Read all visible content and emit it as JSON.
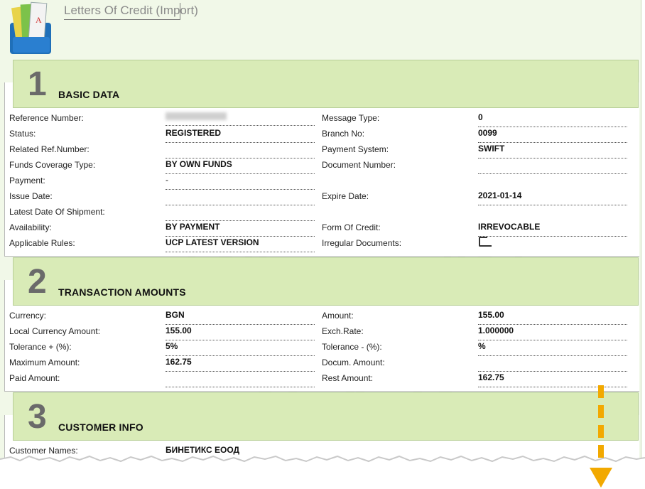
{
  "page": {
    "title": "Letters Of Credit (Import)"
  },
  "icons": {
    "app_icon": "document-binder-icon",
    "scroll_hint": "dashed-down-arrow-icon"
  },
  "colors": {
    "section_header_bg": "#d9ebb7",
    "page_bg": "#f1f8e8",
    "arrow": "#f2a900"
  },
  "sections": [
    {
      "number": "1",
      "title": "BASIC DATA",
      "rows": [
        {
          "left_label": "Reference Number:",
          "left_value": "",
          "right_label": "Message Type:",
          "right_value": "0"
        },
        {
          "left_label": "Status:",
          "left_value": "REGISTERED",
          "right_label": "Branch No:",
          "right_value": "0099"
        },
        {
          "left_label": "Related Ref.Number:",
          "left_value": "",
          "right_label": "Payment System:",
          "right_value": "SWIFT"
        },
        {
          "left_label": "Funds Coverage Type:",
          "left_value": "BY OWN FUNDS",
          "right_label": "Document Number:",
          "right_value": ""
        },
        {
          "left_label": "Payment:",
          "left_value": "-",
          "right_label": "",
          "right_value": ""
        },
        {
          "left_label": "Issue Date:",
          "left_value": "",
          "right_label": "Expire Date:",
          "right_value": "2021-01-14"
        },
        {
          "left_label": "Latest Date Of Shipment:",
          "left_value": "",
          "right_label": "",
          "right_value": ""
        },
        {
          "left_label": "Availability:",
          "left_value": "BY PAYMENT",
          "right_label": "Form Of Credit:",
          "right_value": "IRREVOCABLE"
        },
        {
          "left_label": "Applicable Rules:",
          "left_value": "UCP LATEST VERSION",
          "right_label": "Irregular Documents:",
          "right_value": ""
        }
      ]
    },
    {
      "number": "2",
      "title": "TRANSACTION AMOUNTS",
      "rows": [
        {
          "left_label": "Currency:",
          "left_value": "BGN",
          "right_label": "Amount:",
          "right_value": "155.00"
        },
        {
          "left_label": "Local Currency Amount:",
          "left_value": "155.00",
          "right_label": "Exch.Rate:",
          "right_value": "1.000000"
        },
        {
          "left_label": "Tolerance + (%):",
          "left_value": "5%",
          "right_label": "Tolerance - (%):",
          "right_value": "%"
        },
        {
          "left_label": "Maximum Amount:",
          "left_value": "162.75",
          "right_label": "Docum. Amount:",
          "right_value": ""
        },
        {
          "left_label": "Paid Amount:",
          "left_value": "",
          "right_label": "Rest Amount:",
          "right_value": "162.75"
        }
      ]
    },
    {
      "number": "3",
      "title": "CUSTOMER INFO",
      "rows": [
        {
          "left_label": "Customer Names:",
          "left_value": "БИНЕТИКС ЕООД",
          "right_label": "",
          "right_value": ""
        }
      ]
    }
  ]
}
